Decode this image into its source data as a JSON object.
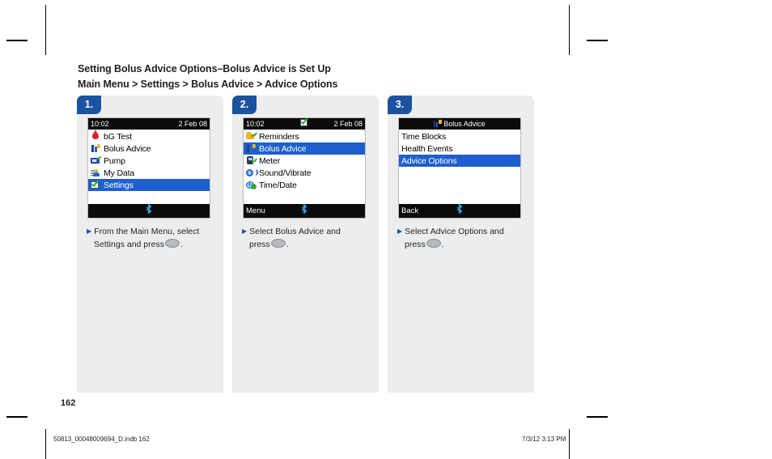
{
  "document": {
    "heading_line1": "Setting Bolus Advice Options–Bolus Advice is Set Up",
    "heading_line2": "Main Menu > Settings > Bolus Advice > Advice Options",
    "page_number": "162",
    "footer_left": "50813_00048009694_D.indb   162",
    "footer_right": "7/3/12   3:13 PM"
  },
  "colors": {
    "accent_blue": "#1b53a0",
    "selection_blue": "#1f5fcd",
    "panel_bg": "#eceded",
    "screen_black": "#0b0b0d",
    "bluetooth_blue": "#2a9fe0"
  },
  "steps": [
    {
      "badge": "1.",
      "screen": {
        "titlebar": {
          "left": "10:02",
          "center": "",
          "right": "2 Feb 08",
          "center_icon": ""
        },
        "items": [
          {
            "label": "bG Test",
            "icon": "blood-drop-icon",
            "selected": false
          },
          {
            "label": "Bolus Advice",
            "icon": "bolus-advice-icon",
            "selected": false
          },
          {
            "label": "Pump",
            "icon": "pump-icon",
            "selected": false
          },
          {
            "label": "My Data",
            "icon": "my-data-icon",
            "selected": false
          },
          {
            "label": "Settings",
            "icon": "settings-check-icon",
            "selected": true
          }
        ],
        "statusbar": {
          "label": "",
          "icon": "bluetooth-icon"
        }
      },
      "caption_line1": "From the Main Menu, select",
      "caption_line2_pre": "Settings and press",
      "caption_line2_post": "."
    },
    {
      "badge": "2.",
      "screen": {
        "titlebar": {
          "left": "10:02",
          "center": "",
          "right": "2 Feb 08",
          "center_icon": "settings-check-icon"
        },
        "items": [
          {
            "label": "Reminders",
            "icon": "reminders-icon",
            "selected": false
          },
          {
            "label": "Bolus Advice",
            "icon": "bolus-advice-icon",
            "selected": true
          },
          {
            "label": "Meter",
            "icon": "meter-icon",
            "selected": false
          },
          {
            "label": "Sound/Vibrate",
            "icon": "sound-vibrate-icon",
            "selected": false
          },
          {
            "label": "Time/Date",
            "icon": "time-date-icon",
            "selected": false
          }
        ],
        "statusbar": {
          "label": "Menu",
          "icon": "bluetooth-icon"
        }
      },
      "caption_line1": "Select Bolus Advice and",
      "caption_line2_pre": "press",
      "caption_line2_post": "."
    },
    {
      "badge": "3.",
      "screen": {
        "titlebar": {
          "left": "",
          "center": "Bolus Advice",
          "right": "",
          "center_icon": "bolus-advice-icon"
        },
        "items": [
          {
            "label": "Time Blocks",
            "icon": "",
            "selected": false
          },
          {
            "label": "Health Events",
            "icon": "",
            "selected": false
          },
          {
            "label": "Advice Options",
            "icon": "",
            "selected": true
          }
        ],
        "statusbar": {
          "label": "Back",
          "icon": "bluetooth-icon"
        }
      },
      "caption_line1": "Select Advice Options and",
      "caption_line2_pre": "press",
      "caption_line2_post": "."
    }
  ]
}
